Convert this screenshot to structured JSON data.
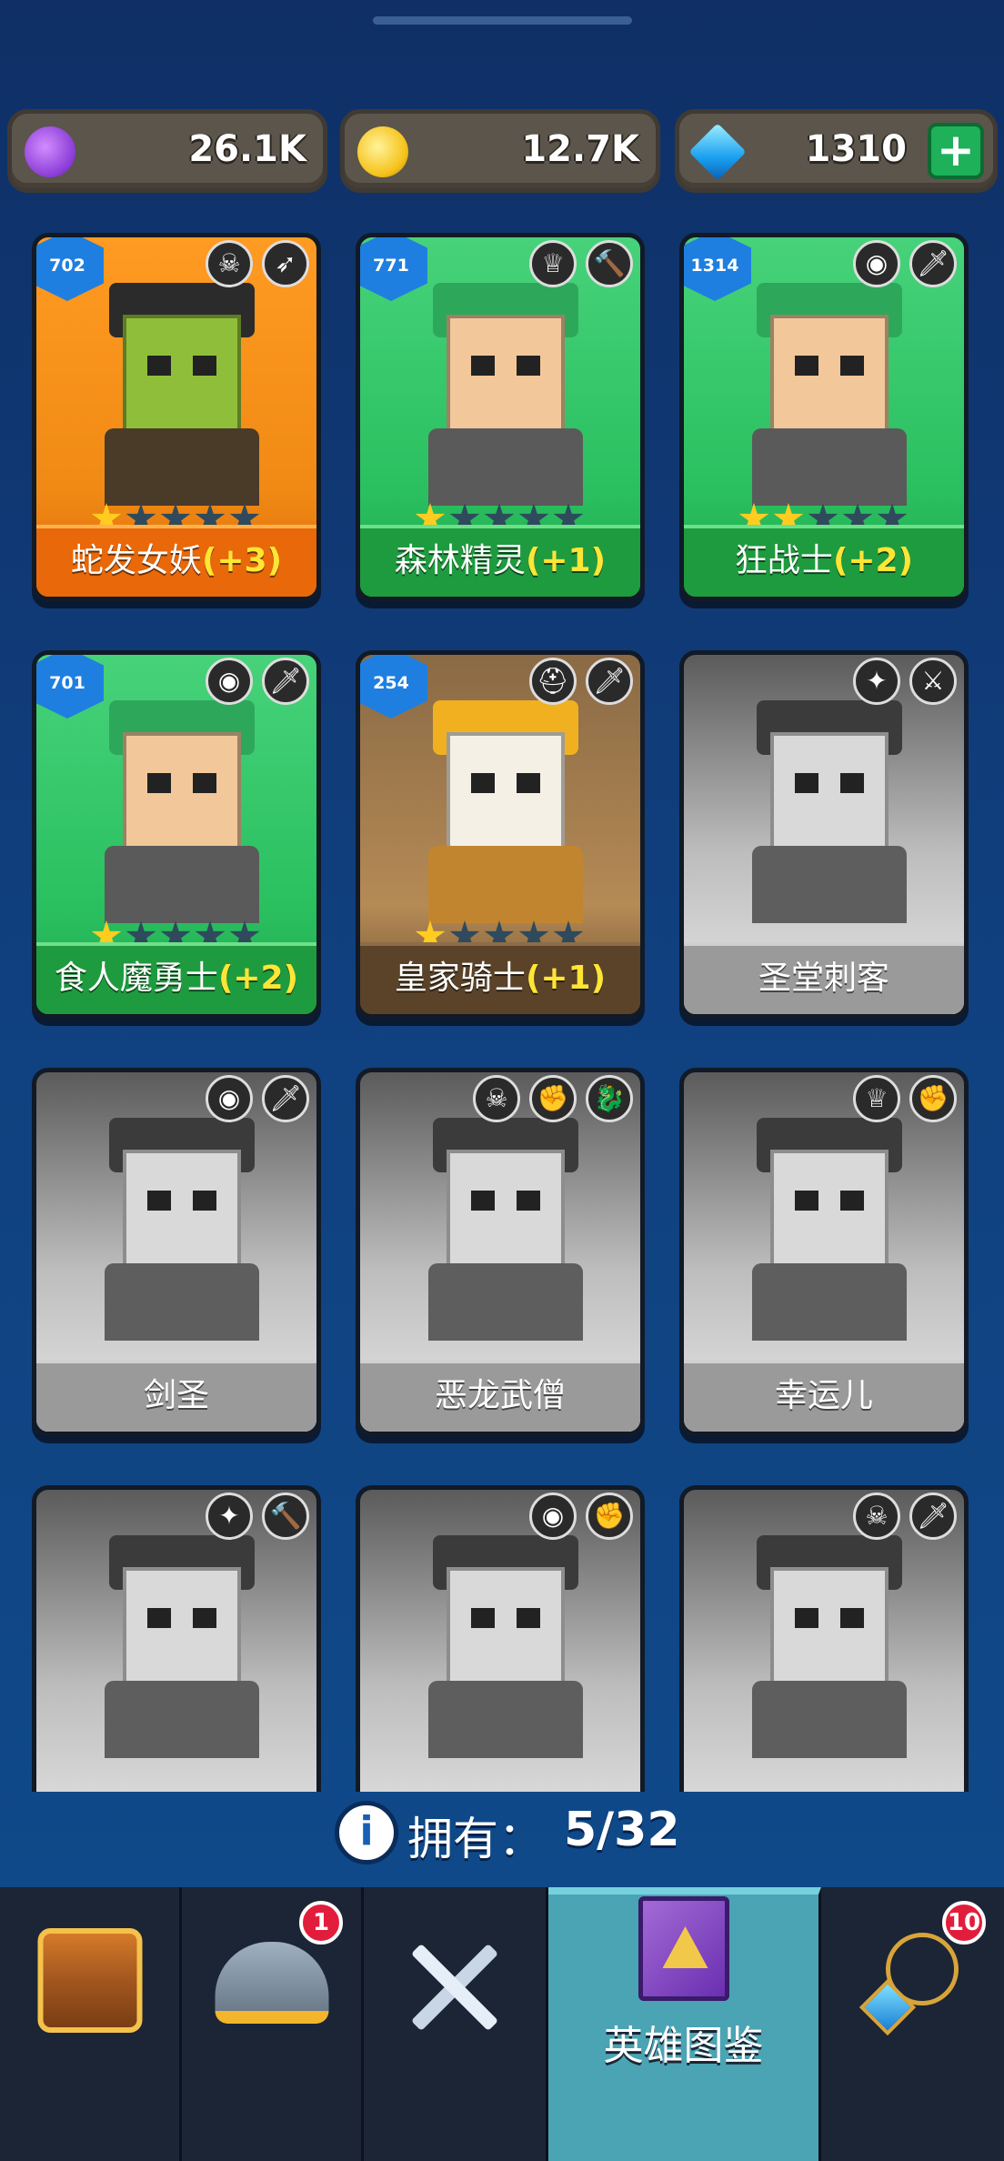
{
  "currencies": {
    "elixir": {
      "value": "26.1K",
      "icon": "purple-elixir-icon"
    },
    "gold": {
      "value": "12.7K",
      "icon": "gold-coin-icon"
    },
    "gems": {
      "value": "1310",
      "icon": "blue-gem-icon",
      "plus_label": "+"
    }
  },
  "heroes": [
    {
      "name": "蛇发女妖",
      "bonus": "(+3)",
      "level": "702",
      "stars": 1,
      "owned": true,
      "theme": "orange",
      "tags": [
        "☠",
        "➶"
      ]
    },
    {
      "name": "森林精灵",
      "bonus": "(+1)",
      "level": "771",
      "stars": 1,
      "owned": true,
      "theme": "green",
      "tags": [
        "♕",
        "🔨"
      ]
    },
    {
      "name": "狂战士",
      "bonus": "(+2)",
      "level": "1314",
      "stars": 2,
      "owned": true,
      "theme": "green",
      "tags": [
        "◉",
        "🗡"
      ]
    },
    {
      "name": "食人魔勇士",
      "bonus": "(+2)",
      "level": "701",
      "stars": 1,
      "owned": true,
      "theme": "green",
      "tags": [
        "◉",
        "🗡"
      ]
    },
    {
      "name": "皇家骑士",
      "bonus": "(+1)",
      "level": "254",
      "stars": 1,
      "owned": true,
      "theme": "brown",
      "tags": [
        "⛑",
        "🗡"
      ]
    },
    {
      "name": "圣堂刺客",
      "bonus": "",
      "level": "",
      "stars": 0,
      "owned": false,
      "theme": "gray",
      "tags": [
        "✦",
        "⚔"
      ]
    },
    {
      "name": "剑圣",
      "bonus": "",
      "level": "",
      "stars": 0,
      "owned": false,
      "theme": "gray",
      "tags": [
        "◉",
        "🗡"
      ]
    },
    {
      "name": "恶龙武僧",
      "bonus": "",
      "level": "",
      "stars": 0,
      "owned": false,
      "theme": "gray",
      "tags": [
        "☠",
        "✊",
        "🐉"
      ]
    },
    {
      "name": "幸运儿",
      "bonus": "",
      "level": "",
      "stars": 0,
      "owned": false,
      "theme": "gray",
      "tags": [
        "♕",
        "✊"
      ]
    },
    {
      "name": "",
      "bonus": "",
      "level": "",
      "stars": 0,
      "owned": false,
      "theme": "gray",
      "tags": [
        "✦",
        "🔨"
      ]
    },
    {
      "name": "",
      "bonus": "",
      "level": "",
      "stars": 0,
      "owned": false,
      "theme": "gray",
      "tags": [
        "◉",
        "✊"
      ]
    },
    {
      "name": "",
      "bonus": "",
      "level": "",
      "stars": 0,
      "owned": false,
      "theme": "gray",
      "tags": [
        "☠",
        "🗡"
      ]
    }
  ],
  "owned": {
    "label": "拥有：",
    "count": "5/32",
    "info_icon": "i"
  },
  "tabs": [
    {
      "name": "shop",
      "icon": "treasure-chest-icon",
      "label": "",
      "badge": ""
    },
    {
      "name": "heroes",
      "icon": "viking-helmet-icon",
      "label": "",
      "badge": "1"
    },
    {
      "name": "battle",
      "icon": "crossed-swords-icon",
      "label": "",
      "badge": ""
    },
    {
      "name": "codex",
      "icon": "spell-book-icon",
      "label": "英雄图鉴",
      "badge": ""
    },
    {
      "name": "amulet",
      "icon": "amulet-icon",
      "label": "",
      "badge": "10"
    }
  ],
  "colors": {
    "accent": "#4aa4b3",
    "bonus": "#ffe535",
    "star_on": "#ffcc1f"
  }
}
